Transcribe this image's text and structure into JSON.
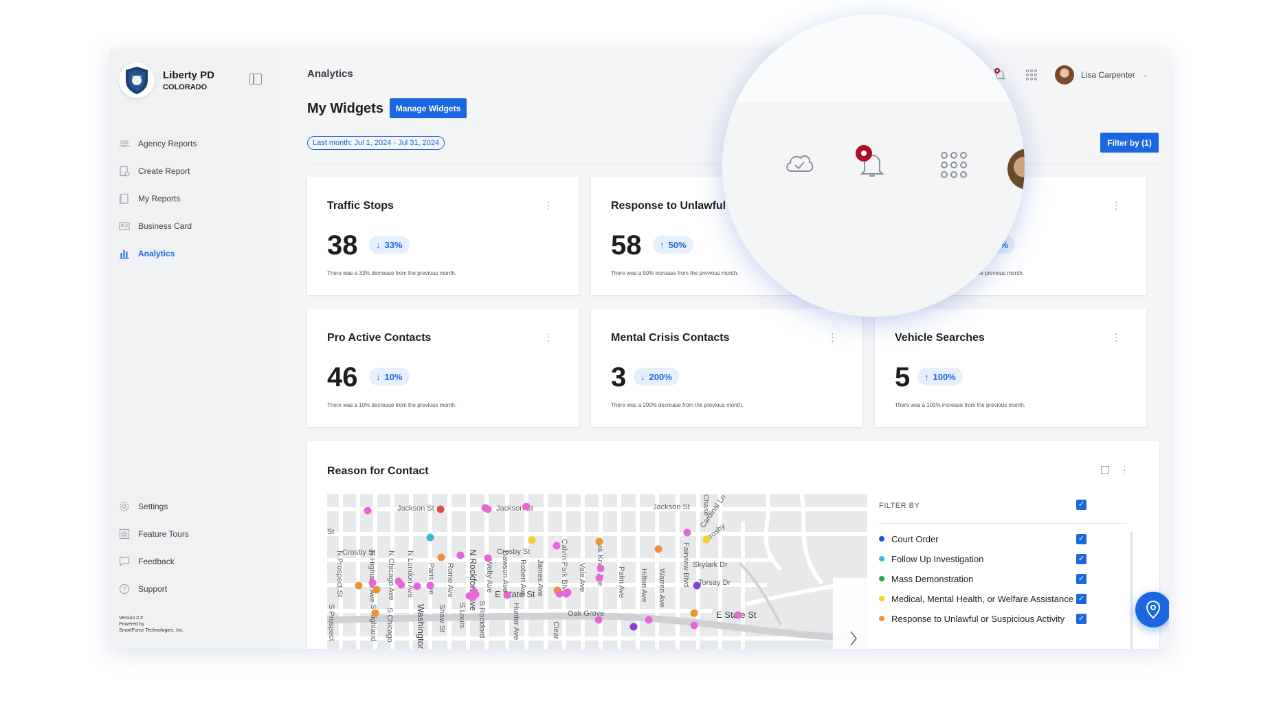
{
  "sidebar": {
    "org_name": "Liberty PD",
    "org_state": "COLORADO",
    "items": [
      {
        "label": "Agency Reports",
        "icon": "people-icon"
      },
      {
        "label": "Create Report",
        "icon": "create-report-icon"
      },
      {
        "label": "My Reports",
        "icon": "reports-icon"
      },
      {
        "label": "Business Card",
        "icon": "business-card-icon"
      },
      {
        "label": "Analytics",
        "icon": "bar-chart-icon",
        "active": true
      }
    ],
    "bottom_items": [
      {
        "label": "Settings",
        "icon": "gear-icon"
      },
      {
        "label": "Feature Tours",
        "icon": "star-icon"
      },
      {
        "label": "Feedback",
        "icon": "chat-icon"
      },
      {
        "label": "Support",
        "icon": "help-icon"
      }
    ],
    "version": "Version #.#",
    "powered_by": "Powered by",
    "company": "SmartForce Technologies, Inc."
  },
  "header": {
    "title": "Analytics",
    "user_name": "Lisa Carpenter"
  },
  "widgets": {
    "title": "My Widgets",
    "manage_label": "Manage Widgets",
    "date_range": "Last month: Jul 1, 2024 - Jul 31, 2024",
    "filter_label": "Filter by (1)"
  },
  "cards": [
    {
      "title": "Traffic Stops",
      "value": "38",
      "arrow": "↓",
      "change": "33%",
      "desc": "There was a 33% decrease from the previous month."
    },
    {
      "title": "Response to Unlawful A",
      "value": "58",
      "arrow": "↑",
      "change": "50%",
      "desc": "There was a 50% increase from the previous month."
    },
    {
      "title": "",
      "value": "",
      "arrow": "",
      "change": "25%",
      "desc": "n the previous month."
    },
    {
      "title": "Pro Active Contacts",
      "value": "46",
      "arrow": "↓",
      "change": "10%",
      "desc": "There was a 10% decrease from the previous month."
    },
    {
      "title": "Mental Crisis Contacts",
      "value": "3",
      "arrow": "↓",
      "change": "200%",
      "desc": "There was a 200% decrease from the previous month."
    },
    {
      "title": "Vehicle Searches",
      "value": "5",
      "arrow": "↑",
      "change": "100%",
      "desc": "There was a 100% increase from the previous month."
    }
  ],
  "map_panel": {
    "title": "Reason for Contact",
    "filter_heading": "FILTER BY",
    "filters": [
      {
        "label": "Court Order",
        "color": "#1a56d6"
      },
      {
        "label": "Follow Up Investigation",
        "color": "#3bbbe0"
      },
      {
        "label": "Mass Demonstration",
        "color": "#2aa84a"
      },
      {
        "label": "Medical, Mental Health, or Welfare Assistance",
        "color": "#f2cf2a"
      },
      {
        "label": "Response to Unlawful or Suspicious Activity",
        "color": "#f0913a"
      }
    ],
    "street_labels": [
      "Jackson St",
      "Jackson St",
      "Jackson St",
      "Crosby St",
      "Crosby St",
      "E State St",
      "E State St",
      "Oak Grove",
      "Skylark Dr",
      "Torsay Dr",
      "Cardinal Ln",
      "Crosby",
      "N Prospect St",
      "N Highland Ave",
      "N Chicago Ave",
      "N London Ave",
      "Paris Ave",
      "Rome Ave",
      "N Rockford Ave",
      "Welty Ave",
      "Dawson Ave",
      "Robert Ave",
      "James Ave",
      "Calvin Park Blvd",
      "Oak Knoll Ave",
      "Vale Ave",
      "Palm Ave",
      "Hilton Ave",
      "Warren Ave",
      "Fairview Blvd",
      "S Prospect",
      "S Highland",
      "S Chicago",
      "Washington",
      "Shaw St",
      "S Louis",
      "S Rockford",
      "Hunter Ave",
      "Clear",
      "St",
      "Chase"
    ]
  },
  "colors": {
    "accent": "#1a67e0",
    "pink_marker": "#e767d8",
    "red_marker": "#e24b4b",
    "purple_marker": "#8a3fd4"
  }
}
